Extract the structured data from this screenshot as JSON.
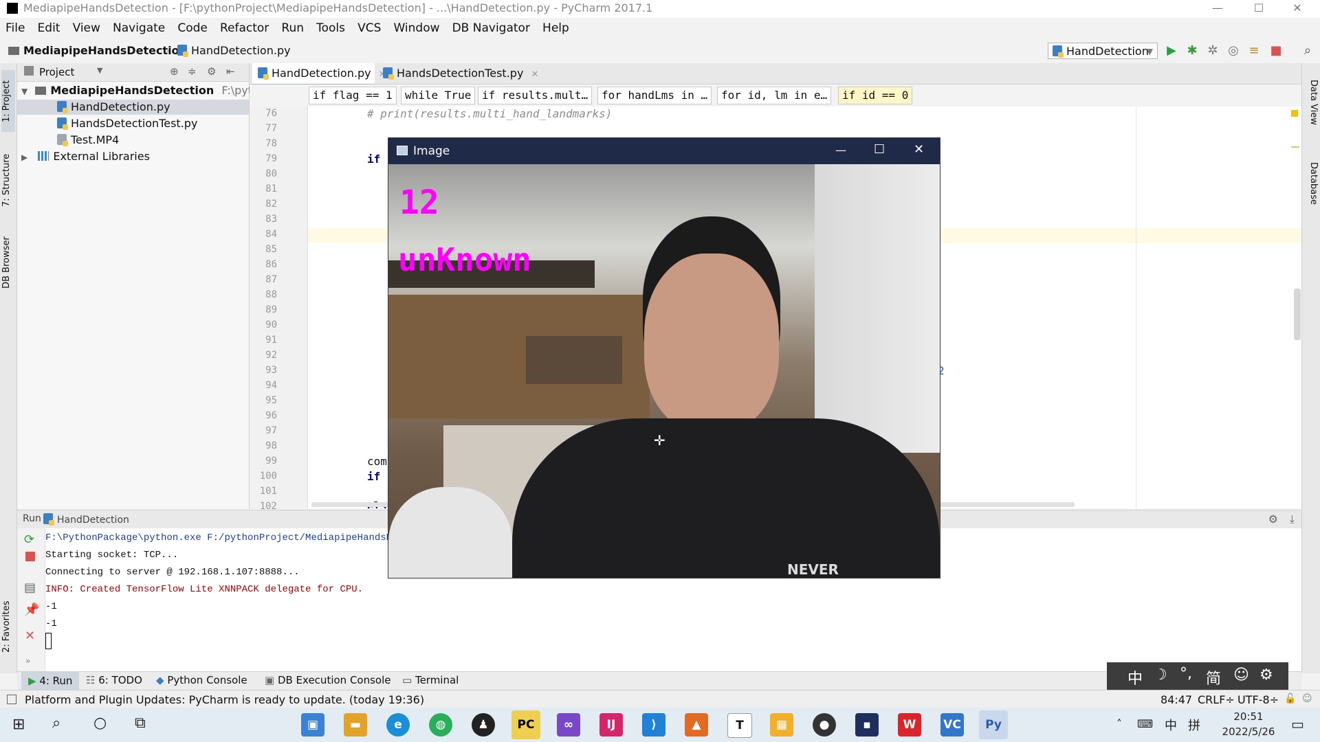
{
  "window": {
    "title": "MediapipeHandsDetection - [F:\\pythonProject\\MediapipeHandsDetection] - ...\\HandDetection.py - PyCharm 2017.1",
    "min": "—",
    "max": "☐",
    "close": "✕"
  },
  "menu": [
    "File",
    "Edit",
    "View",
    "Navigate",
    "Code",
    "Refactor",
    "Run",
    "Tools",
    "VCS",
    "Window",
    "DB Navigator",
    "Help"
  ],
  "nav": {
    "project": "MediapipeHandsDetection",
    "file": "HandDetection.py",
    "run_config": "HandDetection"
  },
  "left_tabs": [
    "1: Project",
    "7: Structure",
    "DB Browser",
    "2: Favorites"
  ],
  "right_tabs": [
    "Data View",
    "Database"
  ],
  "project_panel": {
    "header": "Project",
    "root": "MediapipeHandsDetection",
    "root_path": "F:\\python",
    "files": [
      "HandDetection.py",
      "HandsDetectionTest.py",
      "Test.MP4"
    ],
    "external": "External Libraries"
  },
  "editor": {
    "tabs": [
      "HandDetection.py",
      "HandsDetectionTest.py"
    ],
    "breadcrumbs": [
      "if flag == 1",
      "while True",
      "if results.mult…",
      "for handLms in …",
      "for id, lm in e…",
      "if id == 0"
    ],
    "line_numbers": [
      "76",
      "77",
      "78",
      "79",
      "80",
      "81",
      "82",
      "83",
      "84",
      "85",
      "86",
      "87",
      "88",
      "89",
      "90",
      "91",
      "92",
      "93",
      "94",
      "95",
      "96",
      "97",
      "98",
      "99",
      "100",
      "101",
      "102"
    ],
    "code_comment": "# print(results.multi_hand_landmarks)",
    "code_if1": "if",
    "code_com": "com",
    "code_if2": "if",
    "code_els": "els",
    "right_digit": "2"
  },
  "run_panel": {
    "label": "Run",
    "config": "HandDetection",
    "lines": [
      "F:\\PythonPackage\\python.exe F:/pythonProject/MediapipeHandsDet",
      "Starting socket: TCP...",
      "Connecting to server @ 192.168.1.107:8888...",
      "INFO: Created TensorFlow Lite XNNPACK delegate for CPU.",
      "-1",
      "-1"
    ]
  },
  "tool_tabs": [
    "4: Run",
    "6: TODO",
    "Python Console",
    "DB Execution Console",
    "Terminal"
  ],
  "status": {
    "message": "Platform and Plugin Updates: PyCharm is ready to update. (today 19:36)",
    "position": "84:47",
    "line_sep": "CRLF÷",
    "encoding": "UTF-8÷"
  },
  "image_window": {
    "title": "Image",
    "overlay_count": "12",
    "overlay_label": "unKnown",
    "shirt_text": "NEVER"
  },
  "ime": [
    "中",
    "☽",
    "°,",
    "简",
    "☺",
    "⚙"
  ],
  "taskbar": {
    "time": "20:51",
    "date": "2022/5/26",
    "lang": "中",
    "apps": [
      "store",
      "explorer",
      "edge",
      "wechat",
      "qq",
      "pycharm",
      "vs",
      "intellij",
      "vscode",
      "matlab",
      "typora",
      "office",
      "recorder",
      "other",
      "wps",
      "vc",
      "python"
    ]
  },
  "colors": {
    "accent": "#ff00ff",
    "image_titlebar": "#1f2a48"
  }
}
